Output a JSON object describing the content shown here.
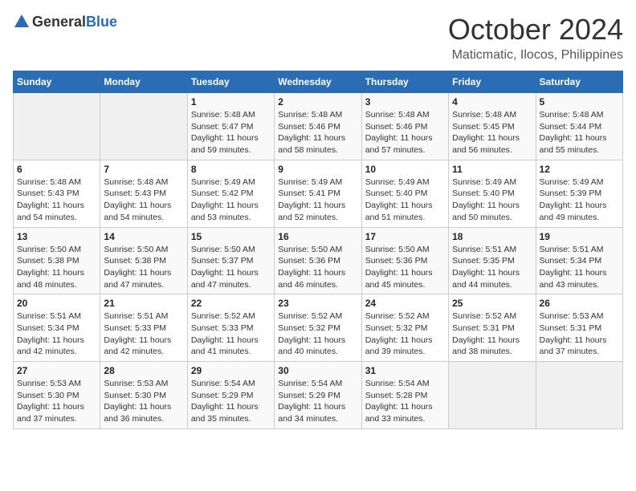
{
  "header": {
    "logo_general": "General",
    "logo_blue": "Blue",
    "month": "October 2024",
    "location": "Maticmatic, Ilocos, Philippines"
  },
  "weekdays": [
    "Sunday",
    "Monday",
    "Tuesday",
    "Wednesday",
    "Thursday",
    "Friday",
    "Saturday"
  ],
  "weeks": [
    [
      {
        "day": "",
        "sunrise": "",
        "sunset": "",
        "daylight": ""
      },
      {
        "day": "",
        "sunrise": "",
        "sunset": "",
        "daylight": ""
      },
      {
        "day": "1",
        "sunrise": "5:48 AM",
        "sunset": "5:47 PM",
        "daylight": "11 hours and 59 minutes."
      },
      {
        "day": "2",
        "sunrise": "5:48 AM",
        "sunset": "5:46 PM",
        "daylight": "11 hours and 58 minutes."
      },
      {
        "day": "3",
        "sunrise": "5:48 AM",
        "sunset": "5:46 PM",
        "daylight": "11 hours and 57 minutes."
      },
      {
        "day": "4",
        "sunrise": "5:48 AM",
        "sunset": "5:45 PM",
        "daylight": "11 hours and 56 minutes."
      },
      {
        "day": "5",
        "sunrise": "5:48 AM",
        "sunset": "5:44 PM",
        "daylight": "11 hours and 55 minutes."
      }
    ],
    [
      {
        "day": "6",
        "sunrise": "5:48 AM",
        "sunset": "5:43 PM",
        "daylight": "11 hours and 54 minutes."
      },
      {
        "day": "7",
        "sunrise": "5:48 AM",
        "sunset": "5:43 PM",
        "daylight": "11 hours and 54 minutes."
      },
      {
        "day": "8",
        "sunrise": "5:49 AM",
        "sunset": "5:42 PM",
        "daylight": "11 hours and 53 minutes."
      },
      {
        "day": "9",
        "sunrise": "5:49 AM",
        "sunset": "5:41 PM",
        "daylight": "11 hours and 52 minutes."
      },
      {
        "day": "10",
        "sunrise": "5:49 AM",
        "sunset": "5:40 PM",
        "daylight": "11 hours and 51 minutes."
      },
      {
        "day": "11",
        "sunrise": "5:49 AM",
        "sunset": "5:40 PM",
        "daylight": "11 hours and 50 minutes."
      },
      {
        "day": "12",
        "sunrise": "5:49 AM",
        "sunset": "5:39 PM",
        "daylight": "11 hours and 49 minutes."
      }
    ],
    [
      {
        "day": "13",
        "sunrise": "5:50 AM",
        "sunset": "5:38 PM",
        "daylight": "11 hours and 48 minutes."
      },
      {
        "day": "14",
        "sunrise": "5:50 AM",
        "sunset": "5:38 PM",
        "daylight": "11 hours and 47 minutes."
      },
      {
        "day": "15",
        "sunrise": "5:50 AM",
        "sunset": "5:37 PM",
        "daylight": "11 hours and 47 minutes."
      },
      {
        "day": "16",
        "sunrise": "5:50 AM",
        "sunset": "5:36 PM",
        "daylight": "11 hours and 46 minutes."
      },
      {
        "day": "17",
        "sunrise": "5:50 AM",
        "sunset": "5:36 PM",
        "daylight": "11 hours and 45 minutes."
      },
      {
        "day": "18",
        "sunrise": "5:51 AM",
        "sunset": "5:35 PM",
        "daylight": "11 hours and 44 minutes."
      },
      {
        "day": "19",
        "sunrise": "5:51 AM",
        "sunset": "5:34 PM",
        "daylight": "11 hours and 43 minutes."
      }
    ],
    [
      {
        "day": "20",
        "sunrise": "5:51 AM",
        "sunset": "5:34 PM",
        "daylight": "11 hours and 42 minutes."
      },
      {
        "day": "21",
        "sunrise": "5:51 AM",
        "sunset": "5:33 PM",
        "daylight": "11 hours and 42 minutes."
      },
      {
        "day": "22",
        "sunrise": "5:52 AM",
        "sunset": "5:33 PM",
        "daylight": "11 hours and 41 minutes."
      },
      {
        "day": "23",
        "sunrise": "5:52 AM",
        "sunset": "5:32 PM",
        "daylight": "11 hours and 40 minutes."
      },
      {
        "day": "24",
        "sunrise": "5:52 AM",
        "sunset": "5:32 PM",
        "daylight": "11 hours and 39 minutes."
      },
      {
        "day": "25",
        "sunrise": "5:52 AM",
        "sunset": "5:31 PM",
        "daylight": "11 hours and 38 minutes."
      },
      {
        "day": "26",
        "sunrise": "5:53 AM",
        "sunset": "5:31 PM",
        "daylight": "11 hours and 37 minutes."
      }
    ],
    [
      {
        "day": "27",
        "sunrise": "5:53 AM",
        "sunset": "5:30 PM",
        "daylight": "11 hours and 37 minutes."
      },
      {
        "day": "28",
        "sunrise": "5:53 AM",
        "sunset": "5:30 PM",
        "daylight": "11 hours and 36 minutes."
      },
      {
        "day": "29",
        "sunrise": "5:54 AM",
        "sunset": "5:29 PM",
        "daylight": "11 hours and 35 minutes."
      },
      {
        "day": "30",
        "sunrise": "5:54 AM",
        "sunset": "5:29 PM",
        "daylight": "11 hours and 34 minutes."
      },
      {
        "day": "31",
        "sunrise": "5:54 AM",
        "sunset": "5:28 PM",
        "daylight": "11 hours and 33 minutes."
      },
      {
        "day": "",
        "sunrise": "",
        "sunset": "",
        "daylight": ""
      },
      {
        "day": "",
        "sunrise": "",
        "sunset": "",
        "daylight": ""
      }
    ]
  ],
  "labels": {
    "sunrise_prefix": "Sunrise: ",
    "sunset_prefix": "Sunset: ",
    "daylight_prefix": "Daylight: "
  }
}
